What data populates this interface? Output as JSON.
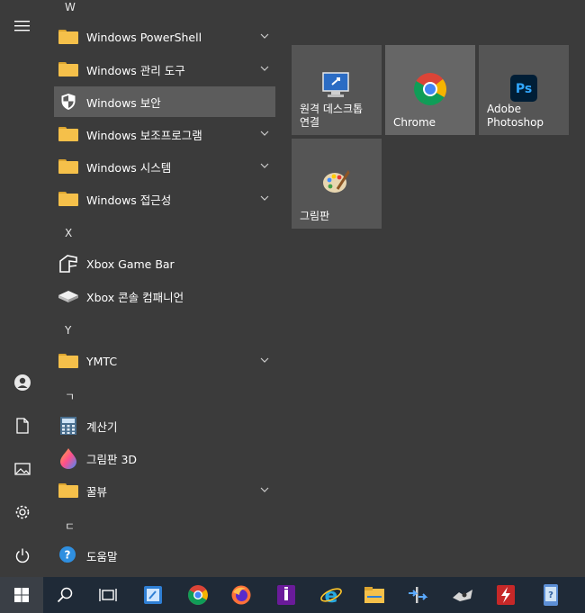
{
  "app_list": {
    "sections": [
      {
        "letter": "W"
      },
      {
        "letter": "X"
      },
      {
        "letter": "Y"
      },
      {
        "letter": "ㄱ"
      },
      {
        "letter": "ㄷ"
      }
    ],
    "items": [
      {
        "label": "Windows PowerShell",
        "icon": "folder-icon",
        "expandable": true
      },
      {
        "label": "Windows 관리 도구",
        "icon": "folder-icon",
        "expandable": true
      },
      {
        "label": "Windows 보안",
        "icon": "shield-icon",
        "expandable": false,
        "selected": true
      },
      {
        "label": "Windows 보조프로그램",
        "icon": "folder-icon",
        "expandable": true
      },
      {
        "label": "Windows 시스템",
        "icon": "folder-icon",
        "expandable": true
      },
      {
        "label": "Windows 접근성",
        "icon": "folder-icon",
        "expandable": true
      },
      {
        "label": "Xbox Game Bar",
        "icon": "xbox-game-bar-icon",
        "expandable": false
      },
      {
        "label": "Xbox 콘솔 컴패니언",
        "icon": "xbox-console-icon",
        "expandable": false
      },
      {
        "label": "YMTC",
        "icon": "folder-icon",
        "expandable": true
      },
      {
        "label": "계산기",
        "icon": "calculator-icon",
        "expandable": false
      },
      {
        "label": "그림판 3D",
        "icon": "paint3d-icon",
        "expandable": false
      },
      {
        "label": "꿀뷰",
        "icon": "folder-icon",
        "expandable": true
      },
      {
        "label": "도움말",
        "icon": "help-icon",
        "expandable": false
      }
    ]
  },
  "left_rail": [
    "hamburger-menu-icon",
    "user-icon",
    "documents-icon",
    "pictures-icon",
    "settings-icon",
    "power-icon"
  ],
  "tiles": [
    {
      "label": "원격 데스크톱\n연결",
      "icon": "remote-desktop-icon"
    },
    {
      "label": "Chrome",
      "icon": "chrome-icon"
    },
    {
      "label": "Adobe\nPhotoshop",
      "icon": "photoshop-icon"
    },
    {
      "label": "그림판",
      "icon": "paint-icon"
    }
  ],
  "taskbar": {
    "items": [
      "start-icon",
      "search-icon",
      "task-view-icon",
      "app-icon",
      "chrome-icon",
      "firefox-icon",
      "app-icon",
      "edge-icon",
      "file-explorer-icon",
      "app-icon",
      "app-icon",
      "app-icon",
      "app-icon"
    ],
    "ps_text": "Ps"
  },
  "colors": {
    "background": "#3b3b3b",
    "tile": "#555555",
    "selected": "#5c5c5c",
    "taskbar": "#1f2a37",
    "folder": "#f5c04a"
  }
}
